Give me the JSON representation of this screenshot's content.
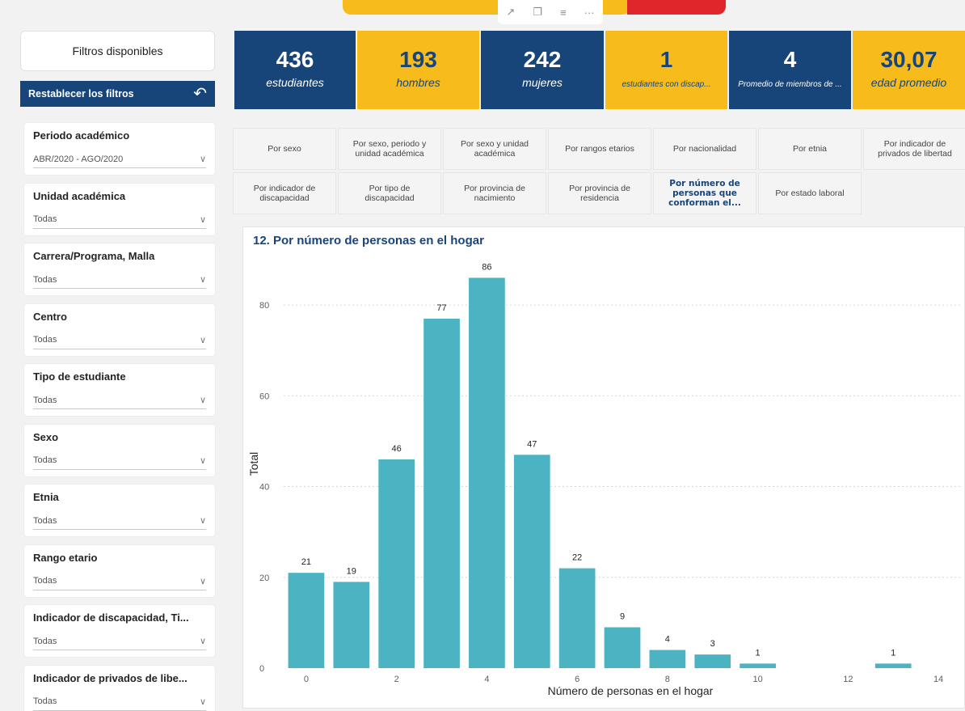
{
  "toolbar": {
    "pin_icon": "pin-icon",
    "copy_icon": "copy-icon",
    "filter_icon": "filter-icon",
    "more_label": "···"
  },
  "sidebar": {
    "title": "Filtros disponibles",
    "reset_label": "Restablecer los filtros",
    "slicers": [
      {
        "label": "Periodo académico",
        "value": "ABR/2020 - AGO/2020"
      },
      {
        "label": "Unidad académica",
        "value": "Todas"
      },
      {
        "label": "Carrera/Programa, Malla",
        "value": "Todas"
      },
      {
        "label": "Centro",
        "value": "Todas"
      },
      {
        "label": "Tipo de estudiante",
        "value": "Todas"
      },
      {
        "label": "Sexo",
        "value": "Todas"
      },
      {
        "label": "Etnia",
        "value": "Todas"
      },
      {
        "label": "Rango etario",
        "value": "Todas"
      },
      {
        "label": "Indicador de discapacidad, Ti...",
        "value": "Todas"
      },
      {
        "label": "Indicador de privados de libe...",
        "value": "Todas"
      }
    ]
  },
  "kpis": [
    {
      "value": "436",
      "label": "estudiantes"
    },
    {
      "value": "193",
      "label": "hombres"
    },
    {
      "value": "242",
      "label": "mujeres"
    },
    {
      "value": "1",
      "label": "estudiantes con discap..."
    },
    {
      "value": "4",
      "label": "Promedio de miembros de ..."
    },
    {
      "value": "30,07",
      "label": "edad promedio"
    }
  ],
  "tabs": [
    {
      "label": "Por sexo"
    },
    {
      "label": "Por sexo, periodo y unidad académica"
    },
    {
      "label": "Por sexo y unidad académica"
    },
    {
      "label": "Por rangos etarios"
    },
    {
      "label": "Por nacionalidad"
    },
    {
      "label": "Por etnia"
    },
    {
      "label": "Por indicador de privados de libertad"
    },
    {
      "label": "Por indicador de discapacidad"
    },
    {
      "label": "Por tipo de discapacidad"
    },
    {
      "label": "Por provincia de nacimiento"
    },
    {
      "label": "Por provincia de residencia"
    },
    {
      "label": "Por número de personas que conforman el...",
      "active": true
    },
    {
      "label": "Por estado laboral"
    }
  ],
  "colors": {
    "navy": "#17457a",
    "yellow": "#f7bc1c",
    "bar": "#4bb3c1"
  },
  "chart_data": {
    "type": "bar",
    "title": "12. Por número de personas en el hogar",
    "xlabel": "Número de personas en el hogar",
    "ylabel": "Total",
    "x": [
      0,
      1,
      2,
      3,
      4,
      5,
      6,
      7,
      8,
      9,
      10,
      13
    ],
    "values": [
      21,
      19,
      46,
      77,
      86,
      47,
      22,
      9,
      4,
      3,
      1,
      1
    ],
    "xticks": [
      0,
      2,
      4,
      6,
      8,
      10,
      12,
      14
    ],
    "yticks": [
      0,
      20,
      40,
      60,
      80
    ],
    "xlim": [
      -0.5,
      14.5
    ],
    "ylim": [
      0,
      90
    ],
    "grid": true
  }
}
